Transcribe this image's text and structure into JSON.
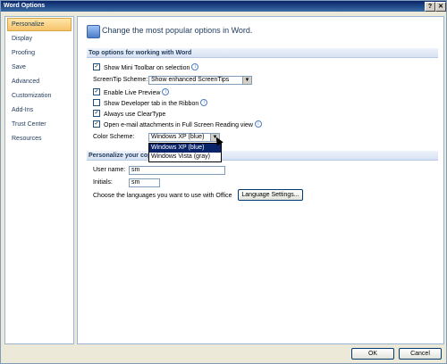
{
  "window": {
    "title": "Word Options",
    "help_button": "?",
    "close_button": "✕"
  },
  "sidebar": {
    "items": [
      {
        "label": "Personalize",
        "active": true
      },
      {
        "label": "Display"
      },
      {
        "label": "Proofing"
      },
      {
        "label": "Save"
      },
      {
        "label": "Advanced"
      },
      {
        "label": "Customization"
      },
      {
        "label": "Add-Ins"
      },
      {
        "label": "Trust Center"
      },
      {
        "label": "Resources"
      }
    ]
  },
  "header": {
    "text": "Change the most popular options in Word."
  },
  "top_options": {
    "title": "Top options for working with Word",
    "show_mini_toolbar": {
      "label": "Show Mini Toolbar on selection",
      "checked": true
    },
    "screentip_label": "ScreenTip Scheme:",
    "screentip_value": "Show enhanced ScreenTips",
    "enable_live_preview": {
      "label": "Enable Live Preview",
      "checked": true
    },
    "show_developer_tab": {
      "label": "Show Developer tab in the Ribbon",
      "checked": false
    },
    "always_use_cleartype": {
      "label": "Always use ClearType",
      "checked": true
    },
    "open_email_full_screen": {
      "label": "Open e-mail attachments in Full Screen Reading view",
      "checked": true
    },
    "color_scheme_label": "Color Scheme:",
    "color_scheme_value": "Windows XP (blue)",
    "color_scheme_options": [
      "Windows XP (blue)",
      "Windows Vista (gray)"
    ]
  },
  "personalize_copy": {
    "title": "Personalize your copy",
    "username_label": "User name:",
    "username_value": "sm",
    "initials_label": "Initials:",
    "initials_value": "sm",
    "languages_text": "Choose the languages you want to use with Office",
    "language_settings_button": "Language Settings..."
  },
  "footer": {
    "ok_label": "OK",
    "cancel_label": "Cancel"
  },
  "colors": {
    "title_bar": "#0a246a",
    "accent": "#1e395b",
    "selection": "#0a246a"
  }
}
